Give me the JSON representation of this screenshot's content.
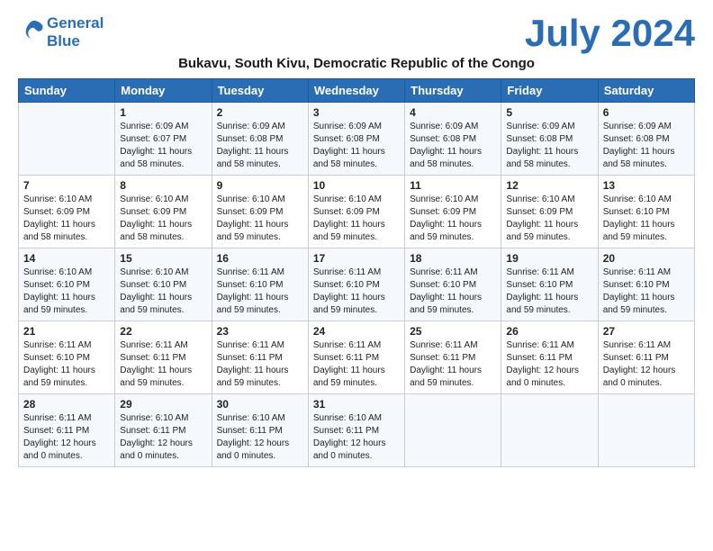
{
  "header": {
    "logo_line1": "General",
    "logo_line2": "Blue",
    "month_title": "July 2024",
    "subtitle": "Bukavu, South Kivu, Democratic Republic of the Congo"
  },
  "days_of_week": [
    "Sunday",
    "Monday",
    "Tuesday",
    "Wednesday",
    "Thursday",
    "Friday",
    "Saturday"
  ],
  "weeks": [
    [
      {
        "day": "",
        "info": ""
      },
      {
        "day": "1",
        "info": "Sunrise: 6:09 AM\nSunset: 6:07 PM\nDaylight: 11 hours and 58 minutes."
      },
      {
        "day": "2",
        "info": "Sunrise: 6:09 AM\nSunset: 6:08 PM\nDaylight: 11 hours and 58 minutes."
      },
      {
        "day": "3",
        "info": "Sunrise: 6:09 AM\nSunset: 6:08 PM\nDaylight: 11 hours and 58 minutes."
      },
      {
        "day": "4",
        "info": "Sunrise: 6:09 AM\nSunset: 6:08 PM\nDaylight: 11 hours and 58 minutes."
      },
      {
        "day": "5",
        "info": "Sunrise: 6:09 AM\nSunset: 6:08 PM\nDaylight: 11 hours and 58 minutes."
      },
      {
        "day": "6",
        "info": "Sunrise: 6:09 AM\nSunset: 6:08 PM\nDaylight: 11 hours and 58 minutes."
      }
    ],
    [
      {
        "day": "7",
        "info": "Sunrise: 6:10 AM\nSunset: 6:09 PM\nDaylight: 11 hours and 58 minutes."
      },
      {
        "day": "8",
        "info": "Sunrise: 6:10 AM\nSunset: 6:09 PM\nDaylight: 11 hours and 58 minutes."
      },
      {
        "day": "9",
        "info": "Sunrise: 6:10 AM\nSunset: 6:09 PM\nDaylight: 11 hours and 59 minutes."
      },
      {
        "day": "10",
        "info": "Sunrise: 6:10 AM\nSunset: 6:09 PM\nDaylight: 11 hours and 59 minutes."
      },
      {
        "day": "11",
        "info": "Sunrise: 6:10 AM\nSunset: 6:09 PM\nDaylight: 11 hours and 59 minutes."
      },
      {
        "day": "12",
        "info": "Sunrise: 6:10 AM\nSunset: 6:09 PM\nDaylight: 11 hours and 59 minutes."
      },
      {
        "day": "13",
        "info": "Sunrise: 6:10 AM\nSunset: 6:10 PM\nDaylight: 11 hours and 59 minutes."
      }
    ],
    [
      {
        "day": "14",
        "info": "Sunrise: 6:10 AM\nSunset: 6:10 PM\nDaylight: 11 hours and 59 minutes."
      },
      {
        "day": "15",
        "info": "Sunrise: 6:10 AM\nSunset: 6:10 PM\nDaylight: 11 hours and 59 minutes."
      },
      {
        "day": "16",
        "info": "Sunrise: 6:11 AM\nSunset: 6:10 PM\nDaylight: 11 hours and 59 minutes."
      },
      {
        "day": "17",
        "info": "Sunrise: 6:11 AM\nSunset: 6:10 PM\nDaylight: 11 hours and 59 minutes."
      },
      {
        "day": "18",
        "info": "Sunrise: 6:11 AM\nSunset: 6:10 PM\nDaylight: 11 hours and 59 minutes."
      },
      {
        "day": "19",
        "info": "Sunrise: 6:11 AM\nSunset: 6:10 PM\nDaylight: 11 hours and 59 minutes."
      },
      {
        "day": "20",
        "info": "Sunrise: 6:11 AM\nSunset: 6:10 PM\nDaylight: 11 hours and 59 minutes."
      }
    ],
    [
      {
        "day": "21",
        "info": "Sunrise: 6:11 AM\nSunset: 6:10 PM\nDaylight: 11 hours and 59 minutes."
      },
      {
        "day": "22",
        "info": "Sunrise: 6:11 AM\nSunset: 6:11 PM\nDaylight: 11 hours and 59 minutes."
      },
      {
        "day": "23",
        "info": "Sunrise: 6:11 AM\nSunset: 6:11 PM\nDaylight: 11 hours and 59 minutes."
      },
      {
        "day": "24",
        "info": "Sunrise: 6:11 AM\nSunset: 6:11 PM\nDaylight: 11 hours and 59 minutes."
      },
      {
        "day": "25",
        "info": "Sunrise: 6:11 AM\nSunset: 6:11 PM\nDaylight: 11 hours and 59 minutes."
      },
      {
        "day": "26",
        "info": "Sunrise: 6:11 AM\nSunset: 6:11 PM\nDaylight: 12 hours and 0 minutes."
      },
      {
        "day": "27",
        "info": "Sunrise: 6:11 AM\nSunset: 6:11 PM\nDaylight: 12 hours and 0 minutes."
      }
    ],
    [
      {
        "day": "28",
        "info": "Sunrise: 6:11 AM\nSunset: 6:11 PM\nDaylight: 12 hours and 0 minutes."
      },
      {
        "day": "29",
        "info": "Sunrise: 6:10 AM\nSunset: 6:11 PM\nDaylight: 12 hours and 0 minutes."
      },
      {
        "day": "30",
        "info": "Sunrise: 6:10 AM\nSunset: 6:11 PM\nDaylight: 12 hours and 0 minutes."
      },
      {
        "day": "31",
        "info": "Sunrise: 6:10 AM\nSunset: 6:11 PM\nDaylight: 12 hours and 0 minutes."
      },
      {
        "day": "",
        "info": ""
      },
      {
        "day": "",
        "info": ""
      },
      {
        "day": "",
        "info": ""
      }
    ]
  ]
}
